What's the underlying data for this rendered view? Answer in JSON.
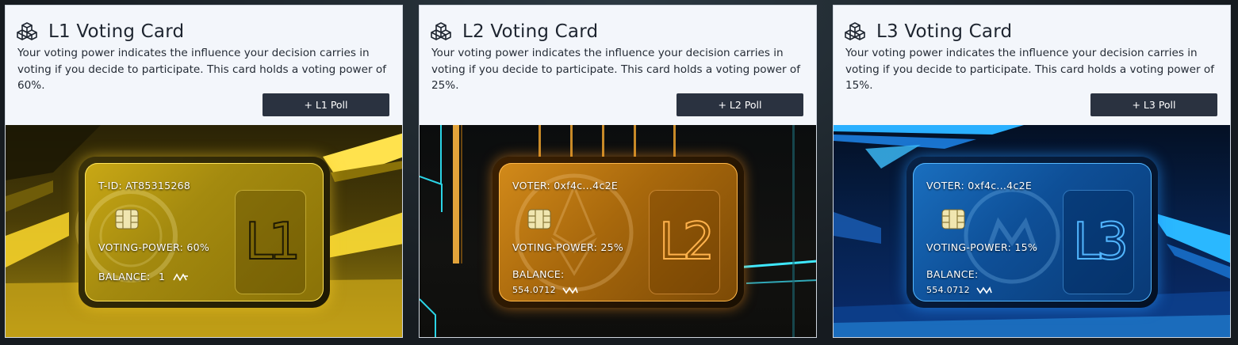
{
  "cards": [
    {
      "title": "L1 Voting Card",
      "description": "Your voting power indicates the influence your decision carries in voting if you decide to participate. This card holds a voting power of 60%.",
      "poll_button": "+ L1 Poll",
      "id_line": "T-ID: AT85315268",
      "voting_power": "VOTING-POWER: 60%",
      "balance_label": "BALANCE:",
      "balance_value": "1",
      "tier": "L1",
      "theme": "#d4b41a",
      "icon": "cube-icon"
    },
    {
      "title": "L2 Voting Card",
      "description": "Your voting power indicates the influence your decision carries in voting if you decide to participate. This card holds a voting power of 25%.",
      "poll_button": "+ L2 Poll",
      "id_line": "VOTER: 0xf4c...4c2E",
      "voting_power": "VOTING-POWER: 25%",
      "balance_label": "BALANCE:",
      "balance_value": "554.0712",
      "tier": "L2",
      "theme": "#e08a1c",
      "icon": "cube-icon"
    },
    {
      "title": "L3 Voting Card",
      "description": "Your voting power indicates the influence your decision carries in voting if you decide to participate. This card holds a voting power of 15%.",
      "poll_button": "+ L3 Poll",
      "id_line": "VOTER: 0xf4c...4c2E",
      "voting_power": "VOTING-POWER: 15%",
      "balance_label": "BALANCE:",
      "balance_value": "554.0712",
      "tier": "L3",
      "theme": "#2f8fe8",
      "icon": "cube-icon"
    }
  ]
}
